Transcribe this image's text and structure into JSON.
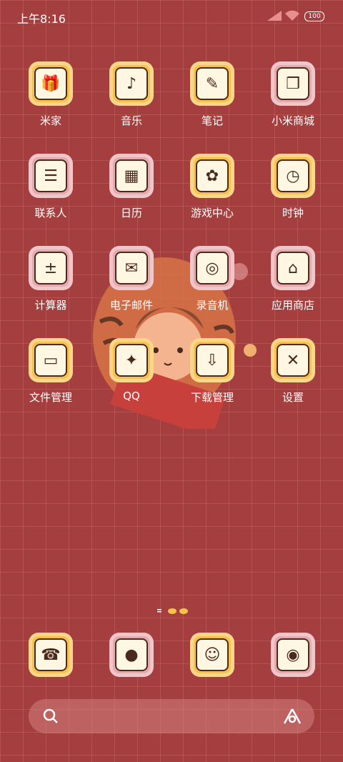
{
  "status_bar": {
    "time": "上午8:16",
    "battery": "100"
  },
  "apps": [
    {
      "label": "米家",
      "icon": "gift-icon",
      "color": "yellow"
    },
    {
      "label": "音乐",
      "icon": "tiger-music-icon",
      "color": "yellow"
    },
    {
      "label": "笔记",
      "icon": "notebook-pen-icon",
      "color": "yellow"
    },
    {
      "label": "小米商城",
      "icon": "shop-bag-icon",
      "color": "pink"
    },
    {
      "label": "联系人",
      "icon": "contacts-card-icon",
      "color": "pink"
    },
    {
      "label": "日历",
      "icon": "calendar-icon",
      "color": "pink"
    },
    {
      "label": "游戏中心",
      "icon": "cat-game-icon",
      "color": "yellow"
    },
    {
      "label": "时钟",
      "icon": "tiger-clock-icon",
      "color": "yellow"
    },
    {
      "label": "计算器",
      "icon": "calculator-icon",
      "color": "pink"
    },
    {
      "label": "电子邮件",
      "icon": "envelope-icon",
      "color": "pink"
    },
    {
      "label": "录音机",
      "icon": "cassette-recorder-icon",
      "color": "pink"
    },
    {
      "label": "应用商店",
      "icon": "app-store-icon",
      "color": "pink"
    },
    {
      "label": "文件管理",
      "icon": "folder-icon",
      "color": "yellow"
    },
    {
      "label": "QQ",
      "icon": "penguin-qq-icon",
      "color": "yellow"
    },
    {
      "label": "下载管理",
      "icon": "download-icon",
      "color": "yellow"
    },
    {
      "label": "设置",
      "icon": "wrench-settings-icon",
      "color": "yellow"
    }
  ],
  "dock": [
    {
      "icon": "phone-icon",
      "color": "yellow"
    },
    {
      "icon": "ball-messages-icon",
      "color": "pink"
    },
    {
      "icon": "tiger-browser-icon",
      "color": "yellow"
    },
    {
      "icon": "camera-icon",
      "color": "pink"
    }
  ],
  "colors": {
    "background": "#a53f3f",
    "icon_yellow": "#f7c14e",
    "icon_pink": "#e7a8ae"
  }
}
